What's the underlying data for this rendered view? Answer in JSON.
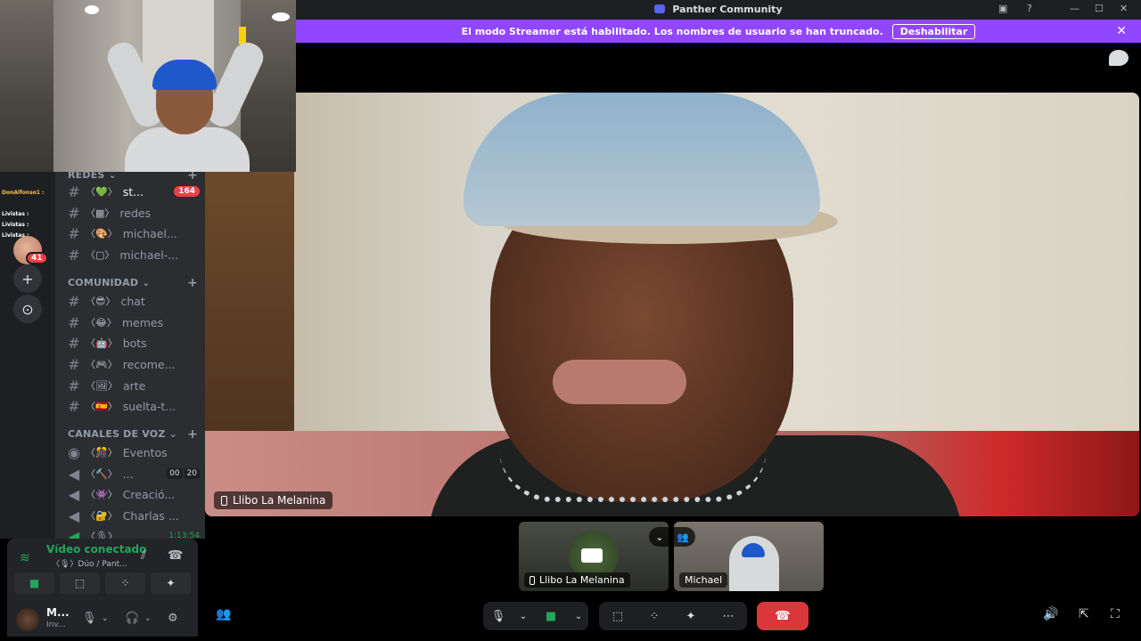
{
  "window": {
    "title": "Panther Community"
  },
  "banner": {
    "text": "El modo Streamer está habilitado. Los nombres de usuario se han truncado.",
    "button_label": "Deshabilitar",
    "close_glyph": "✕"
  },
  "chat_overlay": {
    "lines": [
      "DonAlfonso1 :",
      "Livistas :",
      "Livistas :",
      "Livistas :"
    ]
  },
  "servers": {
    "unread_badge": "41",
    "add_server_glyph": "+",
    "discover_glyph": "⊙"
  },
  "categories": {
    "redes": "REDES",
    "comunidad": "COMUNIDAD",
    "voz": "CANALES DE VOZ"
  },
  "channels": {
    "redes": [
      {
        "emoji": "〈💚〉",
        "name": "st...",
        "badge": "164"
      },
      {
        "emoji": "〈▦〉",
        "name": "redes"
      },
      {
        "emoji": "〈🎨〉",
        "name": "michael..."
      },
      {
        "emoji": "〈▢〉",
        "name": "michael-..."
      }
    ],
    "comunidad": [
      {
        "emoji": "〈😎〉",
        "name": "chat"
      },
      {
        "emoji": "〈😂〉",
        "name": "memes"
      },
      {
        "emoji": "〈🤖〉",
        "name": "bots"
      },
      {
        "emoji": "〈🎮〉",
        "name": "recome..."
      },
      {
        "emoji": "〈🖼〉",
        "name": "arte"
      },
      {
        "emoji": "〈🇪🇸〉",
        "name": "suelta-t..."
      }
    ],
    "voz": [
      {
        "emoji": "〈🎊〉",
        "name": "Eventos"
      },
      {
        "emoji": "〈🔨〉",
        "name": "...",
        "count_a": "00",
        "count_b": "20"
      },
      {
        "emoji": "〈👾〉",
        "name": "Creació..."
      },
      {
        "emoji": "〈🔐〉",
        "name": "Charlas ..."
      },
      {
        "emoji": "〈🎙〉",
        "name": "",
        "time": "1:13:54"
      }
    ]
  },
  "voice_panel": {
    "title": "Vídeo conectado",
    "subtitle": "〈🎙〉Dúo / Pant...",
    "buttons": [
      "■",
      "⬚",
      "⁘",
      "✦"
    ]
  },
  "user_panel": {
    "name": "M...",
    "status": "Inv..."
  },
  "stage": {
    "main_name": "Llibo La Melanina",
    "tiles": [
      {
        "name": "Llibo La Melanina"
      },
      {
        "name": "Michael"
      }
    ]
  },
  "controls": {
    "mic": "🎙",
    "caret": "⌄",
    "camera": "■",
    "screenshare": "⬚",
    "activities": "⁘",
    "soundboard": "✦",
    "more": "⋯",
    "leave": "☎",
    "volume": "🔊",
    "popout": "⇱",
    "fullscreen": "⛶",
    "add_people": "👥"
  },
  "colors": {
    "banner": "#9146ff",
    "leave": "#da373c",
    "connected": "#23a559"
  }
}
